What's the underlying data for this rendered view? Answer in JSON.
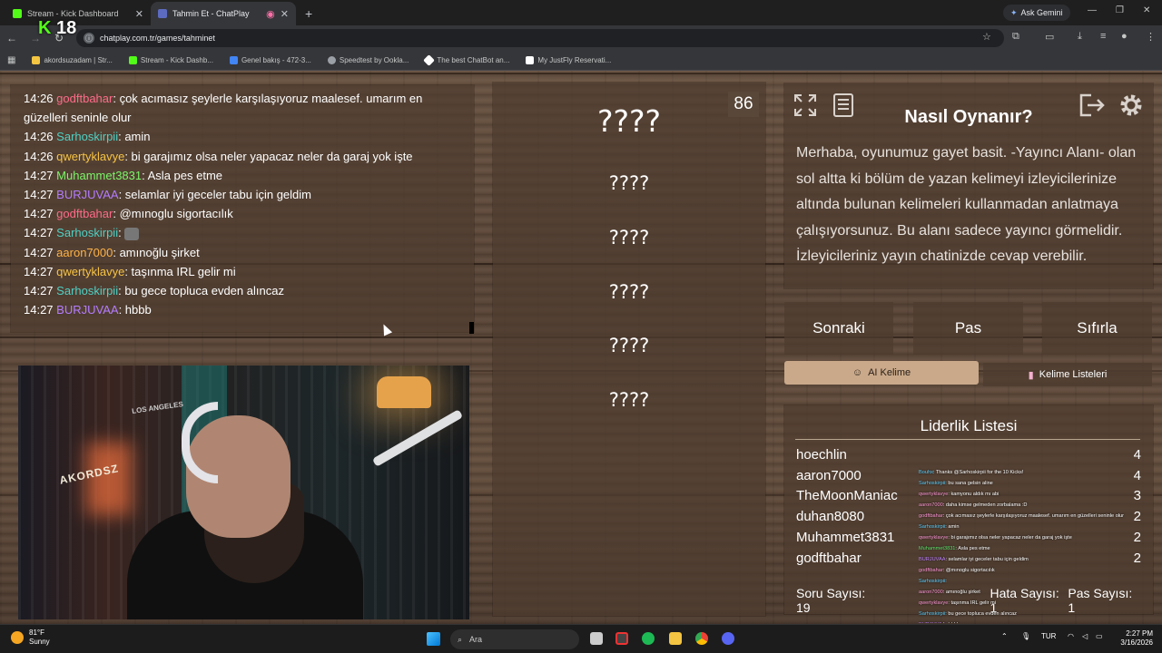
{
  "browser": {
    "tabs": [
      {
        "title": "Stream - Kick Dashboard",
        "active": false,
        "color": "#53fc18"
      },
      {
        "title": "Tahmin Et - ChatPlay",
        "active": true,
        "color": "#5c6bc0"
      }
    ],
    "gemini_label": "Ask Gemini",
    "url": "chatplay.com.tr/games/tahminet",
    "bookmarks": [
      {
        "label": "akordsuzadam | Str...",
        "color": "#f4c542"
      },
      {
        "label": "Stream - Kick Dashb...",
        "color": "#53fc18"
      },
      {
        "label": "Genel bakış - 472-3...",
        "color": "#4285f4"
      },
      {
        "label": "Speedtest by Ookla...",
        "color": "#9aa0a6"
      },
      {
        "label": "The best ChatBot an...",
        "color": "#ffffff"
      },
      {
        "label": "My JustFly Reservati...",
        "color": "#ffffff"
      }
    ],
    "overlay_badge": {
      "k": "K",
      "num": "18"
    }
  },
  "chat": {
    "messages": [
      {
        "time": "14:26",
        "user": "godftbahar",
        "color": "#ff6b8a",
        "text": ": çok acımasız şeylerle karşılaşıyoruz maalesef. umarım en güzelleri seninle olur"
      },
      {
        "time": "14:26",
        "user": "Sarhoskirpii",
        "color": "#4fd1c5",
        "text": ": amin"
      },
      {
        "time": "14:26",
        "user": "qwertyklavye",
        "color": "#f6c344",
        "text": ": bi garajımız olsa neler yapacaz neler da garaj yok işte"
      },
      {
        "time": "14:27",
        "user": "Muhammet3831",
        "color": "#7df56a",
        "text": ": Asla pes etme"
      },
      {
        "time": "14:27",
        "user": "BURJUVAA",
        "color": "#b47cff",
        "text": ": selamlar iyi geceler tabu için geldim"
      },
      {
        "time": "14:27",
        "user": "godftbahar",
        "color": "#ff6b8a",
        "text": ": @mınoglu sigortacılık"
      },
      {
        "time": "14:27",
        "user": "Sarhoskirpii",
        "color": "#4fd1c5",
        "text": ":",
        "emote": true
      },
      {
        "time": "14:27",
        "user": "aaron7000",
        "color": "#ffb347",
        "text": ": amınoğlu şirket"
      },
      {
        "time": "14:27",
        "user": "qwertyklavye",
        "color": "#f6c344",
        "text": ": taşınma IRL gelir mi"
      },
      {
        "time": "14:27",
        "user": "Sarhoskirpii",
        "color": "#4fd1c5",
        "text": ": bu gece topluca evden alıncaz"
      },
      {
        "time": "14:27",
        "user": "BURJUVAA",
        "color": "#b47cff",
        "text": ": hbbb"
      }
    ]
  },
  "webcam": {
    "sign_text": "LOS ANGELES",
    "shirt_text": "AKORDSZ"
  },
  "game": {
    "counter": "86",
    "words": [
      "????",
      "????",
      "????",
      "????",
      "????",
      "????"
    ]
  },
  "howto": {
    "title": "Nasıl Oynanır?",
    "text": "Merhaba, oyunumuz gayet basit. -Yayıncı Alanı- olan sol altta ki bölüm de yazan kelimeyi izleyicilerinize altında bulunan kelimeleri kullanmadan anlatmaya çalışıyorsunuz. Bu alanı sadece yayıncı görmelidir. İzleyicileriniz yayın chatinizde cevap verebilir."
  },
  "controls": {
    "next": "Sonraki",
    "pass": "Pas",
    "reset": "Sıfırla",
    "ai_tab": "AI Kelime",
    "lists_tab": "Kelime Listeleri"
  },
  "leaderboard": {
    "title": "Liderlik Listesi",
    "rows": [
      {
        "name": "hoechlin",
        "score": "4"
      },
      {
        "name": "aaron7000",
        "score": "4"
      },
      {
        "name": "TheMoonManiac",
        "score": "3"
      },
      {
        "name": "duhan8080",
        "score": "2"
      },
      {
        "name": "Muhammet3831",
        "score": "2"
      },
      {
        "name": "godftbahar",
        "score": "2"
      }
    ],
    "question_count": "Soru Sayısı: 19",
    "error_count": "Hata Sayısı: 1",
    "pass_count": "Pas Sayısı: 1"
  },
  "chat_overlay": [
    {
      "user": "Bouhx",
      "text": ": Thanks @Sarhoskirpii for the 10 Kicks!",
      "cls": "u1"
    },
    {
      "user": "Sarhoskirpii",
      "text": ": bu sana gelsin aline",
      "cls": "u1"
    },
    {
      "user": "qwertyklavye",
      "text": ": kamyonu aldık mı abi",
      "cls": "u2"
    },
    {
      "user": "aaron7000",
      "text": ": daha kimse gelmeden zorbalama :D",
      "cls": "u2"
    },
    {
      "user": "godftbahar",
      "text": ": çok acımasız şeylerle karşılaşıyoruz maalesef. umarım en güzelleri seninle olur",
      "cls": "u2"
    },
    {
      "user": "Sarhoskirpii",
      "text": ": amin",
      "cls": "u1"
    },
    {
      "user": "qwertyklavye",
      "text": ": bi garajımız olsa neler yapacaz neler da garaj yok işte",
      "cls": "u2"
    },
    {
      "user": "Muhammet3831",
      "text": ": Asla pes etme",
      "cls": "u3"
    },
    {
      "user": "BURJUVAA",
      "text": ": selamlar iyi geceler tabu için geldim",
      "cls": "u4"
    },
    {
      "user": "godftbahar",
      "text": ": @mınoglu sigortacılık",
      "cls": "u2"
    },
    {
      "user": "Sarhoskirpii",
      "text": ":",
      "cls": "u1"
    },
    {
      "user": "aaron7000",
      "text": ": amınoğlu şirket",
      "cls": "u2"
    },
    {
      "user": "qwertyklavye",
      "text": ": taşınma IRL gelir mi",
      "cls": "u2"
    },
    {
      "user": "Sarhoskirpii",
      "text": ": bu gece topluca evden alıncaz",
      "cls": "u1"
    },
    {
      "user": "BURJUVAA",
      "text": ": hbbb",
      "cls": "u4"
    }
  ],
  "taskbar": {
    "weather_temp": "81°F",
    "weather_desc": "Sunny",
    "search_placeholder": "Ara",
    "lang": "TUR",
    "time": "2:27 PM",
    "date": "3/16/2026"
  }
}
